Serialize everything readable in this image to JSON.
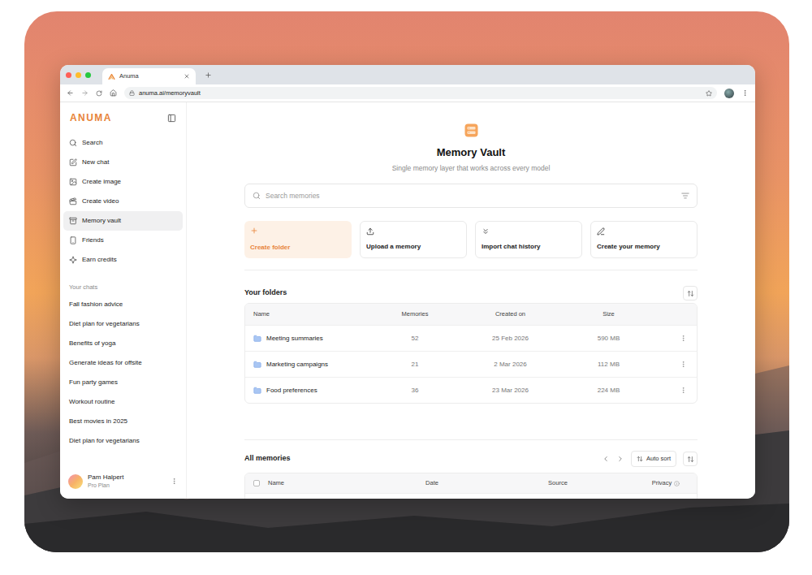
{
  "browser": {
    "tab_title": "Anuma",
    "url": "anuma.ai/memoryvault"
  },
  "sidebar": {
    "logo": "ANUMA",
    "items": [
      {
        "label": "Search",
        "selected": false
      },
      {
        "label": "New chat",
        "selected": false
      },
      {
        "label": "Create image",
        "selected": false
      },
      {
        "label": "Create video",
        "selected": false
      },
      {
        "label": "Memory vault",
        "selected": true
      },
      {
        "label": "Friends",
        "selected": false
      },
      {
        "label": "Earn credits",
        "selected": false
      }
    ],
    "chats_heading": "Your chats",
    "chats": [
      "Fall fashion advice",
      "Diet plan for vegetarians",
      "Benefits of yoga",
      "Generate ideas for offsite",
      "Fun party games",
      "Workout routine",
      "Best movies in 2025",
      "Diet plan for vegetarians"
    ],
    "user": {
      "name": "Pam Halpert",
      "plan": "Pro Plan"
    }
  },
  "main": {
    "title": "Memory Vault",
    "subtitle": "Single memory layer that works across every model",
    "search": {
      "placeholder": "Search memories"
    },
    "actions": [
      {
        "label": "Create folder",
        "kind": "primary"
      },
      {
        "label": "Upload a memory",
        "kind": "default"
      },
      {
        "label": "Import chat history",
        "kind": "default"
      },
      {
        "label": "Create your memory",
        "kind": "default"
      }
    ],
    "folders": {
      "title": "Your folders",
      "columns": [
        "Name",
        "Memories",
        "Created on",
        "Size"
      ],
      "rows": [
        {
          "name": "Meeting summaries",
          "memories": "52",
          "created": "25 Feb 2026",
          "size": "590 MB"
        },
        {
          "name": "Marketing campaigns",
          "memories": "21",
          "created": "2 Mar 2026",
          "size": "112 MB"
        },
        {
          "name": "Food preferences",
          "memories": "36",
          "created": "23 Mar 2026",
          "size": "224 MB"
        }
      ]
    },
    "memories": {
      "title": "All memories",
      "auto_sort": "Auto sort",
      "columns": [
        "Name",
        "Date",
        "Source",
        "Privacy"
      ],
      "rows": [
        {
          "checked": false,
          "privacy": true
        }
      ]
    }
  }
}
